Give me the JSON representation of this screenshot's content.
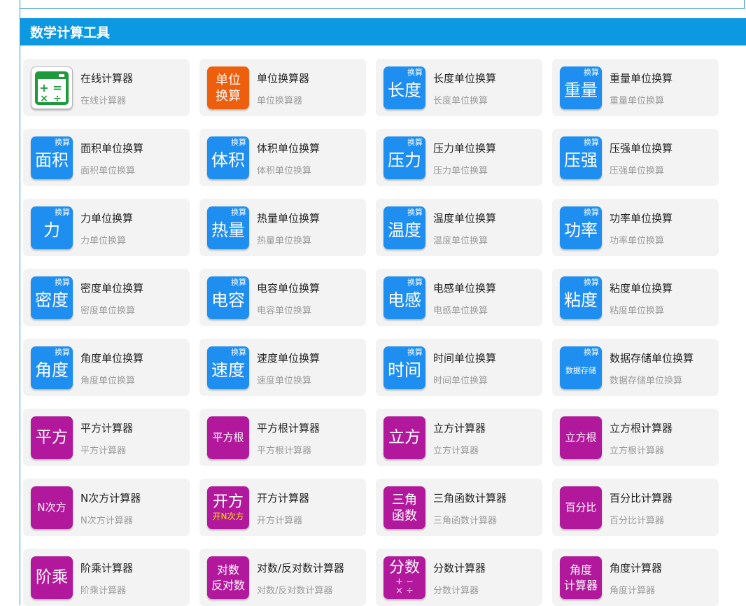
{
  "section": {
    "title": "数学计算工具"
  },
  "tiles": [
    {
      "title": "在线计算器",
      "subtitle": "在线计算器",
      "icon": "calculator-icon",
      "color": "calc"
    },
    {
      "title": "单位换算器",
      "subtitle": "单位换算器",
      "icon_lines": [
        "单位",
        "换算"
      ],
      "color": "orange"
    },
    {
      "title": "长度单位换算",
      "subtitle": "长度单位换算",
      "tag": "换算",
      "big": "长度",
      "color": "blue"
    },
    {
      "title": "重量单位换算",
      "subtitle": "重量单位换算",
      "tag": "换算",
      "big": "重量",
      "color": "blue"
    },
    {
      "title": "面积单位换算",
      "subtitle": "面积单位换算",
      "tag": "换算",
      "big": "面积",
      "color": "blue"
    },
    {
      "title": "体积单位换算",
      "subtitle": "体积单位换算",
      "tag": "换算",
      "big": "体积",
      "color": "blue"
    },
    {
      "title": "压力单位换算",
      "subtitle": "压力单位换算",
      "tag": "换算",
      "big": "压力",
      "color": "blue"
    },
    {
      "title": "压强单位换算",
      "subtitle": "压强单位换算",
      "tag": "换算",
      "big": "压强",
      "color": "blue"
    },
    {
      "title": "力单位换算",
      "subtitle": "力单位换算",
      "tag": "换算",
      "big": "力",
      "color": "blue"
    },
    {
      "title": "热量单位换算",
      "subtitle": "热量单位换算",
      "tag": "换算",
      "big": "热量",
      "color": "blue"
    },
    {
      "title": "温度单位换算",
      "subtitle": "温度单位换算",
      "tag": "换算",
      "big": "温度",
      "color": "blue"
    },
    {
      "title": "功率单位换算",
      "subtitle": "功率单位换算",
      "tag": "换算",
      "big": "功率",
      "color": "blue"
    },
    {
      "title": "密度单位换算",
      "subtitle": "密度单位换算",
      "tag": "换算",
      "big": "密度",
      "color": "blue"
    },
    {
      "title": "电容单位换算",
      "subtitle": "电容单位换算",
      "tag": "换算",
      "big": "电容",
      "color": "blue"
    },
    {
      "title": "电感单位换算",
      "subtitle": "电感单位换算",
      "tag": "换算",
      "big": "电感",
      "color": "blue"
    },
    {
      "title": "粘度单位换算",
      "subtitle": "粘度单位换算",
      "tag": "换算",
      "big": "粘度",
      "color": "blue"
    },
    {
      "title": "角度单位换算",
      "subtitle": "角度单位换算",
      "tag": "换算",
      "big": "角度",
      "color": "blue"
    },
    {
      "title": "速度单位换算",
      "subtitle": "速度单位换算",
      "tag": "换算",
      "big": "速度",
      "color": "blue"
    },
    {
      "title": "时间单位换算",
      "subtitle": "时间单位换算",
      "tag": "换算",
      "big": "时间",
      "color": "blue"
    },
    {
      "title": "数据存储单位换算",
      "subtitle": "数据存储单位换算",
      "tag": "换算",
      "tiny": "数据存储",
      "color": "blue"
    },
    {
      "title": "平方计算器",
      "subtitle": "平方计算器",
      "big2": "平方",
      "color": "purple"
    },
    {
      "title": "平方根计算器",
      "subtitle": "平方根计算器",
      "small": "平方根",
      "color": "purple"
    },
    {
      "title": "立方计算器",
      "subtitle": "立方计算器",
      "big2": "立方",
      "color": "purple"
    },
    {
      "title": "立方根计算器",
      "subtitle": "立方根计算器",
      "small": "立方根",
      "color": "purple"
    },
    {
      "title": "N次方计算器",
      "subtitle": "N次方计算器",
      "small": "N次方",
      "color": "purple"
    },
    {
      "title": "开方计算器",
      "subtitle": "开方计算器",
      "icon_main": "开方",
      "icon_sub": "开N次方",
      "color": "purple"
    },
    {
      "title": "三角函数计算器",
      "subtitle": "三角函数计算器",
      "icon_lines": [
        "三角",
        "函数"
      ],
      "color": "purple"
    },
    {
      "title": "百分比计算器",
      "subtitle": "百分比计算器",
      "small": "百分比",
      "color": "purple"
    },
    {
      "title": "阶乘计算器",
      "subtitle": "阶乘计算器",
      "big2": "阶乘",
      "color": "purple"
    },
    {
      "title": "对数/反对数计算器",
      "subtitle": "对数/反对数计算器",
      "icon_lines2": [
        "对数",
        "反对数"
      ],
      "color": "purple"
    },
    {
      "title": "分数计算器",
      "subtitle": "分数计算器",
      "icon_main": "分数",
      "icon_ops": [
        "+ −",
        "× ÷"
      ],
      "color": "purple"
    },
    {
      "title": "角度计算器",
      "subtitle": "角度计算器",
      "icon_lines2": [
        "角度",
        "计算器"
      ],
      "color": "purple"
    }
  ]
}
